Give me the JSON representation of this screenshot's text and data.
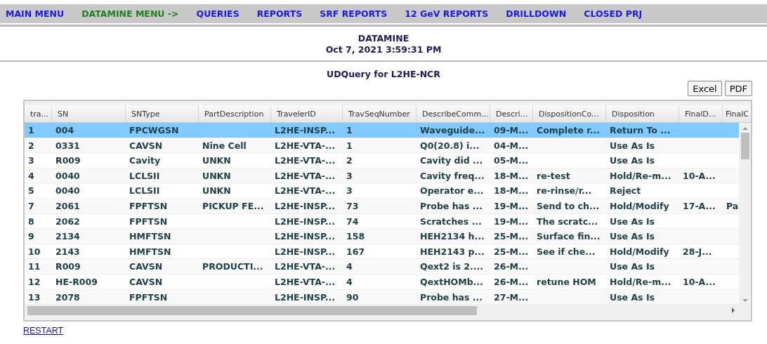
{
  "nav": [
    {
      "label": "MAIN MENU",
      "kind": "link"
    },
    {
      "label": "DATAMINE MENU ->",
      "kind": "current"
    },
    {
      "label": "QUERIES",
      "kind": "link"
    },
    {
      "label": "REPORTS",
      "kind": "link"
    },
    {
      "label": "SRF REPORTS",
      "kind": "link"
    },
    {
      "label": "12 GeV REPORTS",
      "kind": "link"
    },
    {
      "label": "DRILLDOWN",
      "kind": "link"
    },
    {
      "label": "CLOSED PRJ",
      "kind": "link"
    }
  ],
  "header": {
    "title": "DATAMINE",
    "timestamp": "Oct 7, 2021 3:59:31 PM"
  },
  "query_title": "UDQuery for L2HE-NCR",
  "export_buttons": [
    "Excel",
    "PDF"
  ],
  "table": {
    "columns": [
      "tra...",
      "SN",
      "SNType",
      "PartDescription",
      "TravelerID",
      "TravSeqNumber",
      "DescribeComm...",
      "Descri...",
      "DispositionCo...",
      "Disposition",
      "FinalD...",
      "FinalC"
    ],
    "rows": [
      {
        "selected": true,
        "cells": [
          "1",
          "004",
          "FPCWGSN",
          "",
          "L2HE-INSP...",
          "1",
          "Waveguide...",
          "09-M...",
          "Complete r...",
          "Return To ...",
          "",
          ""
        ]
      },
      {
        "selected": false,
        "cells": [
          "2",
          "0331",
          "CAVSN",
          "Nine Cell",
          "L2HE-VTA-...",
          "1",
          "Q0(20.8) i...",
          "04-M...",
          "",
          "Use As Is",
          "",
          ""
        ]
      },
      {
        "selected": false,
        "cells": [
          "3",
          "R009",
          "Cavity",
          "UNKN",
          "L2HE-VTA-...",
          "2",
          "Cavity did ...",
          "05-M...",
          "",
          "Use As Is",
          "",
          ""
        ]
      },
      {
        "selected": false,
        "cells": [
          "4",
          "0040",
          "LCLSII",
          "UNKN",
          "L2HE-VTA-...",
          "3",
          "Cavity freq...",
          "18-M...",
          "re-test",
          "Hold/Re-m...",
          "10-A...",
          ""
        ]
      },
      {
        "selected": false,
        "cells": [
          "5",
          "0040",
          "LCLSII",
          "UNKN",
          "L2HE-VTA-...",
          "3",
          "Operator e...",
          "18-M...",
          "re-rinse/r...",
          "Reject",
          "",
          ""
        ]
      },
      {
        "selected": false,
        "cells": [
          "7",
          "2061",
          "FPFTSN",
          "PICKUP FE...",
          "L2HE-INSP...",
          "73",
          "Probe has ...",
          "19-M...",
          "Send to ch...",
          "Hold/Modify",
          "17-A...",
          "Pa"
        ]
      },
      {
        "selected": false,
        "cells": [
          "8",
          "2062",
          "FPFTSN",
          "",
          "L2HE-INSP...",
          "74",
          "Scratches ...",
          "19-M...",
          "The scratc...",
          "Use As Is",
          "",
          ""
        ]
      },
      {
        "selected": false,
        "cells": [
          "9",
          "2134",
          "HMFTSN",
          "",
          "L2HE-INSP...",
          "158",
          "HEH2134 h...",
          "25-M...",
          "Surface fin...",
          "Use As Is",
          "",
          ""
        ]
      },
      {
        "selected": false,
        "cells": [
          "10",
          "2143",
          "HMFTSN",
          "",
          "L2HE-INSP...",
          "167",
          "HEH2143 p...",
          "25-M...",
          "See if che...",
          "Hold/Modify",
          "28-J...",
          ""
        ]
      },
      {
        "selected": false,
        "cells": [
          "11",
          "R009",
          "CAVSN",
          "PRODUCTI...",
          "L2HE-VTA-...",
          "4",
          "Qext2 is 2....",
          "26-M...",
          "",
          "Use As Is",
          "",
          ""
        ]
      },
      {
        "selected": false,
        "cells": [
          "12",
          "HE-R009",
          "CAVSN",
          "",
          "L2HE-VTA-...",
          "4",
          "QextHOMb...",
          "26-M...",
          "retune HOM",
          "Hold/Re-m...",
          "10-A...",
          ""
        ]
      },
      {
        "selected": false,
        "cells": [
          "13",
          "2078",
          "FPFTSN",
          "",
          "L2HE-INSP...",
          "90",
          "Probe has ...",
          "27-M...",
          "",
          "Use As Is",
          "",
          ""
        ]
      }
    ]
  },
  "restart_link": "RESTART"
}
